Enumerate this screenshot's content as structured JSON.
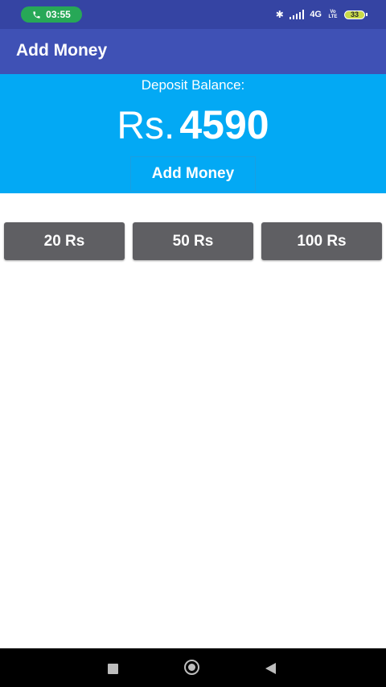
{
  "status_bar": {
    "time": "03:55",
    "network": "4G",
    "volte": "Vo LTE",
    "battery": "33"
  },
  "app_bar": {
    "title": "Add Money"
  },
  "balance": {
    "label": "Deposit Balance:",
    "currency": "Rs.",
    "amount": "4590",
    "add_money_label": "Add Money"
  },
  "quick_amounts": [
    {
      "label": "20 Rs"
    },
    {
      "label": "50 Rs"
    },
    {
      "label": "100 Rs"
    }
  ],
  "colors": {
    "app_bar": "#3f51b5",
    "status_bar": "#3544a3",
    "balance_panel": "#03a9f4",
    "amount_button": "#5f5f63",
    "call_pill": "#27a857"
  }
}
